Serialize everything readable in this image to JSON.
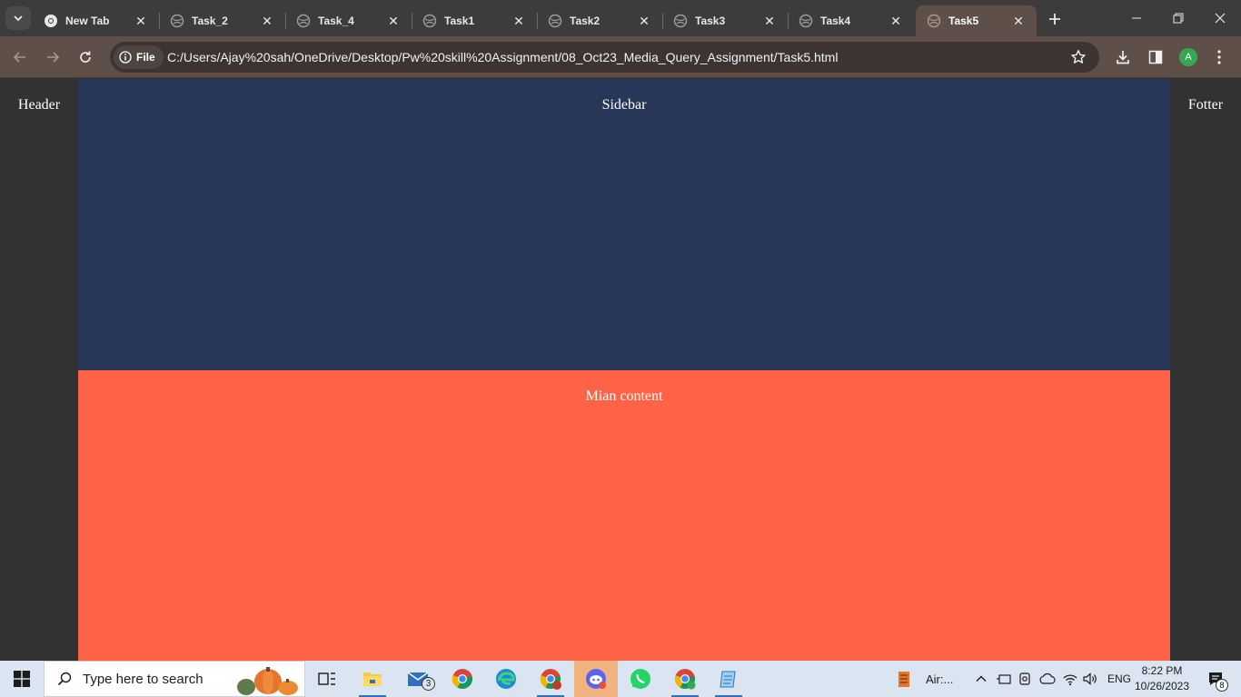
{
  "browser": {
    "tabs": [
      {
        "title": "New Tab",
        "icon": "chrome-icon",
        "active": false
      },
      {
        "title": "Task_2",
        "icon": "globe-icon",
        "active": false
      },
      {
        "title": "Task_4",
        "icon": "globe-icon",
        "active": false
      },
      {
        "title": "Task1",
        "icon": "globe-icon",
        "active": false
      },
      {
        "title": "Task2",
        "icon": "globe-icon",
        "active": false
      },
      {
        "title": "Task3",
        "icon": "globe-icon",
        "active": false
      },
      {
        "title": "Task4",
        "icon": "globe-icon",
        "active": false
      },
      {
        "title": "Task5",
        "icon": "globe-icon",
        "active": true
      }
    ],
    "address": {
      "scheme_label": "File",
      "url": "C:/Users/Ajay%20sah/OneDrive/Desktop/Pw%20skill%20Assignment/08_Oct23_Media_Query_Assignment/Task5.html"
    },
    "profile_initial": "A",
    "colors": {
      "tabstrip": "#3c3c3c",
      "toolbar": "#5e5049",
      "profile": "#36a852"
    }
  },
  "page": {
    "header_label": "Header",
    "sidebar_label": "Sidebar",
    "main_label": "Mian content",
    "footer_label": "Fotter",
    "colors": {
      "side_columns": "#323232",
      "sidebar": "#283758",
      "main": "#ff6347",
      "text": "#ffffff"
    }
  },
  "taskbar": {
    "search_placeholder": "Type here to search",
    "mail_badge": "3",
    "weather_label": "Air:...",
    "language": "ENG",
    "time": "8:22 PM",
    "date": "10/26/2023",
    "notification_count": "8"
  }
}
